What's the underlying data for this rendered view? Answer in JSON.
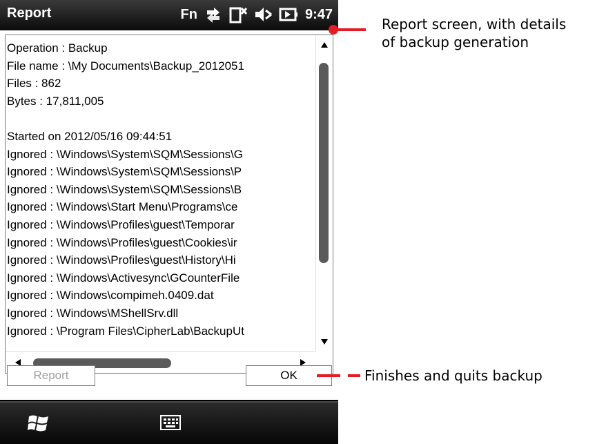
{
  "window": {
    "title": "Report",
    "status": {
      "fn_label": "Fn",
      "time": "9:47",
      "icons": [
        "sync-arrows-icon",
        "no-signal-icon",
        "speaker-muted-icon",
        "battery-charging-icon"
      ]
    }
  },
  "report": {
    "lines": [
      "Operation : Backup",
      "File name : \\My Documents\\Backup_2012051",
      "Files : 862",
      "Bytes : 17,811,005",
      "",
      "Started on 2012/05/16 09:44:51",
      "Ignored : \\Windows\\System\\SQM\\Sessions\\G",
      "Ignored : \\Windows\\System\\SQM\\Sessions\\P",
      "Ignored : \\Windows\\System\\SQM\\Sessions\\B",
      "Ignored : \\Windows\\Start Menu\\Programs\\ce",
      "Ignored : \\Windows\\Profiles\\guest\\Temporar",
      "Ignored : \\Windows\\Profiles\\guest\\Cookies\\ir",
      "Ignored : \\Windows\\Profiles\\guest\\History\\Hi",
      "Ignored : \\Windows\\Activesync\\GCounterFile",
      "Ignored : \\Windows\\compimeh.0409.dat",
      "Ignored : \\Windows\\MShellSrv.dll",
      "Ignored : \\Program Files\\CipherLab\\BackupUt"
    ]
  },
  "buttons": {
    "report_label": "Report",
    "ok_label": "OK"
  },
  "taskbar": {
    "icons": [
      "windows-start-icon",
      "keyboard-icon"
    ]
  },
  "annotations": {
    "report_screen": "Report screen, with details\nof backup generation",
    "finish": "Finishes and quits backup"
  },
  "colors": {
    "callout": "#e41c24",
    "titlebar": "#1a1a1a"
  }
}
